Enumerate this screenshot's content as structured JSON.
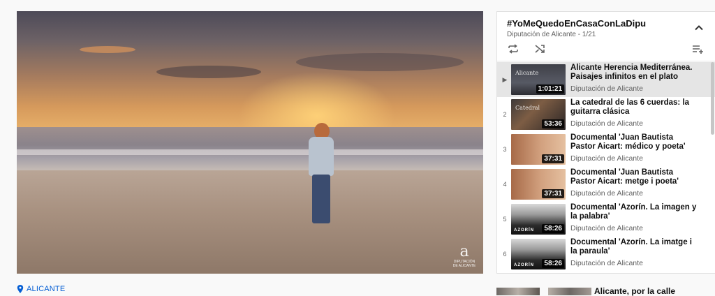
{
  "player": {
    "logo_text": "a",
    "logo_subtext": "DIPUTACIÓN DE ALICANTE"
  },
  "location": {
    "label": "ALICANTE",
    "icon": "map-pin-icon",
    "color": "#065fd4"
  },
  "playlist": {
    "title": "#YoMeQuedoEnCasaConLaDipu",
    "subtitle": "Diputación de Alicante - 1/21",
    "icons": {
      "collapse": "chevron-up-icon",
      "loop": "loop-icon",
      "shuffle": "shuffle-icon",
      "add_to_queue": "add-to-queue-icon"
    },
    "items": [
      {
        "index": "▶",
        "title": "Alicante Herencia Mediterránea. Paisajes infinitos en el plato",
        "channel": "Diputación de Alicante",
        "duration": "1:01:21",
        "thumb_text": "Alicante"
      },
      {
        "index": "2",
        "title": "La catedral de las 6 cuerdas: la guitarra clásica",
        "channel": "Diputación de Alicante",
        "duration": "53:36",
        "thumb_text": "Catedral"
      },
      {
        "index": "3",
        "title": "Documental 'Juan Bautista Pastor Aicart: médico y poeta'",
        "channel": "Diputación de Alicante",
        "duration": "37:31",
        "thumb_text": ""
      },
      {
        "index": "4",
        "title": "Documental 'Juan Bautista Pastor Aicart: metge i poeta'",
        "channel": "Diputación de Alicante",
        "duration": "37:31",
        "thumb_text": ""
      },
      {
        "index": "5",
        "title": "Documental 'Azorín. La imagen y la palabra'",
        "channel": "Diputación de Alicante",
        "duration": "58:26",
        "thumb_text": "AZORÍN"
      },
      {
        "index": "6",
        "title": "Documental 'Azorín. La imatge i la paraula'",
        "channel": "Diputación de Alicante",
        "duration": "58:26",
        "thumb_text": "AZORÍN"
      }
    ]
  },
  "next_video": {
    "title": "Alicante, por la calle"
  }
}
